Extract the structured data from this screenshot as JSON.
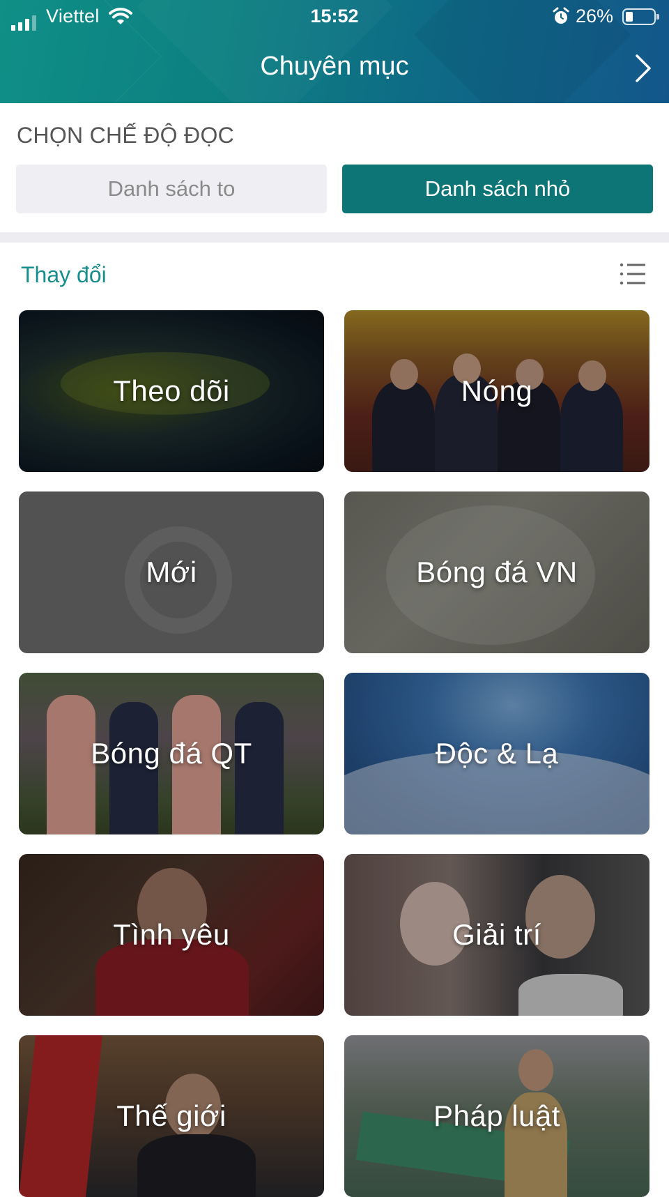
{
  "status_bar": {
    "carrier": "Viettel",
    "time": "15:52",
    "battery": "26%"
  },
  "header": {
    "title": "Chuyên mục"
  },
  "reading_mode": {
    "label": "CHỌN CHẾ ĐỘ ĐỌC",
    "options": [
      {
        "label": "Danh sách to",
        "selected": false
      },
      {
        "label": "Danh sách nhỏ",
        "selected": true
      }
    ],
    "accent_color": "#0d7575"
  },
  "categories_header": {
    "change_link": "Thay đổi"
  },
  "categories": [
    {
      "label": "Theo dõi"
    },
    {
      "label": "Nóng"
    },
    {
      "label": "Mới"
    },
    {
      "label": "Bóng đá VN"
    },
    {
      "label": "Bóng đá QT"
    },
    {
      "label": "Độc & Lạ"
    },
    {
      "label": "Tình yêu"
    },
    {
      "label": "Giải trí"
    },
    {
      "label": "Thế giới"
    },
    {
      "label": "Pháp luật"
    }
  ]
}
